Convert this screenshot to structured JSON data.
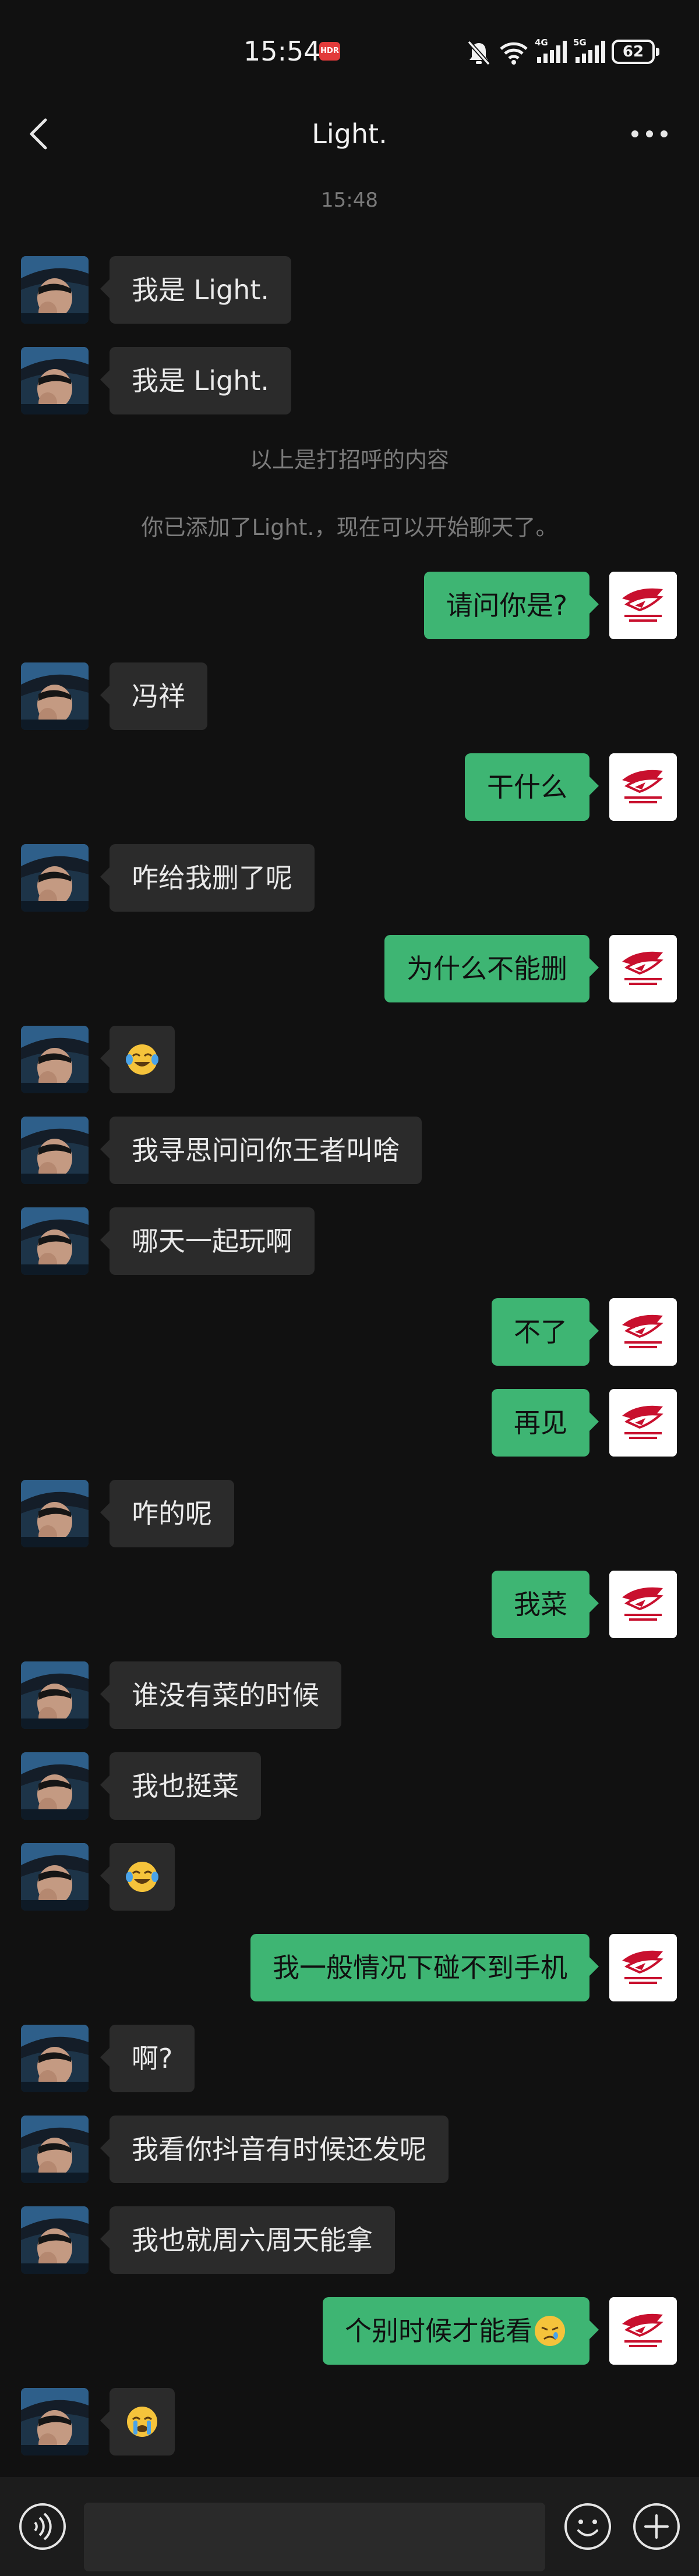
{
  "status_bar": {
    "time": "15:54",
    "hd_badge": "HDR",
    "network_1": "4G",
    "network_2": "5G",
    "battery": "62"
  },
  "nav": {
    "title": "Light."
  },
  "chat": {
    "timestamp": "15:48",
    "system_note_1": "以上是打招呼的内容",
    "system_note_2": "你已添加了Light.，现在可以开始聊天了。",
    "messages": [
      {
        "side": "left",
        "text": "我是 Light."
      },
      {
        "side": "left",
        "text": "我是 Light."
      },
      {
        "side": "right",
        "text": "请问你是?"
      },
      {
        "side": "left",
        "text": "冯祥"
      },
      {
        "side": "right",
        "text": "干什么"
      },
      {
        "side": "left",
        "text": "咋给我删了呢"
      },
      {
        "side": "right",
        "text": "为什么不能删"
      },
      {
        "side": "left",
        "text": "",
        "emoji": "laugh-cry"
      },
      {
        "side": "left",
        "text": "我寻思问问你王者叫啥"
      },
      {
        "side": "left",
        "text": "哪天一起玩啊"
      },
      {
        "side": "right",
        "text": "不了"
      },
      {
        "side": "right",
        "text": "再见"
      },
      {
        "side": "left",
        "text": "咋的呢"
      },
      {
        "side": "right",
        "text": "我菜"
      },
      {
        "side": "left",
        "text": "谁没有菜的时候"
      },
      {
        "side": "left",
        "text": "我也挺菜"
      },
      {
        "side": "left",
        "text": "",
        "emoji": "laugh-cry"
      },
      {
        "side": "right",
        "text": "我一般情况下碰不到手机"
      },
      {
        "side": "left",
        "text": "啊?"
      },
      {
        "side": "left",
        "text": "我看你抖音有时候还发呢"
      },
      {
        "side": "left",
        "text": "我也就周六周天能拿"
      },
      {
        "side": "right",
        "text": "个别时候才能看",
        "emoji": "sad"
      },
      {
        "side": "left",
        "text": "",
        "emoji": "crying"
      }
    ]
  },
  "input_bar": {
    "placeholder": ""
  },
  "colors": {
    "background": "#111111",
    "incoming_bubble": "#2b2b2b",
    "outgoing_bubble": "#3eb573",
    "muted_text": "#7b7b7b"
  }
}
